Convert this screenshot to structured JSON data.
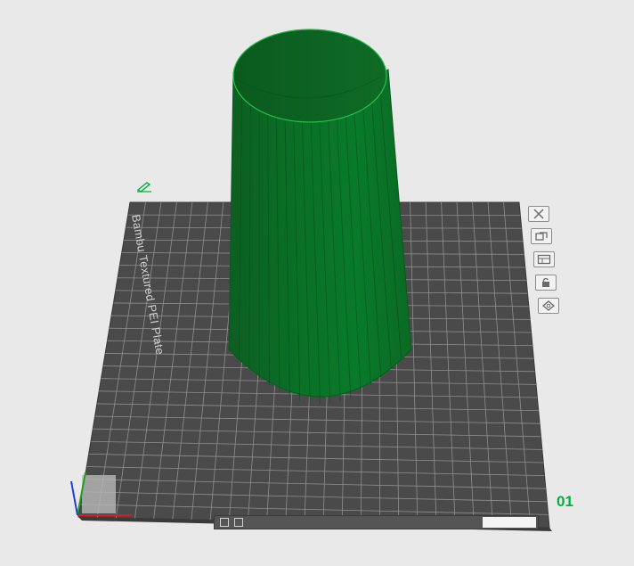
{
  "app": {
    "view": "3D prepare viewport"
  },
  "plate": {
    "name": "Bambu Textured PEI Plate",
    "number": "01",
    "accent_color": "#00ae42",
    "bed_color": "#4a4a4a",
    "grid_color": "#8f8f8f"
  },
  "model": {
    "shape": "ribbed tapered vase",
    "color": "#0b6b23"
  },
  "plate_tools": [
    {
      "name": "remove-plate",
      "icon": "close-icon"
    },
    {
      "name": "auto-arrange",
      "icon": "arrange-icon"
    },
    {
      "name": "plate-settings",
      "icon": "plate-settings-icon"
    },
    {
      "name": "lock-plate",
      "icon": "lock-icon"
    },
    {
      "name": "orient",
      "icon": "orient-icon"
    }
  ],
  "axes": {
    "x_color": "#d22020",
    "y_color": "#20a020",
    "z_color": "#1f3fd8"
  }
}
